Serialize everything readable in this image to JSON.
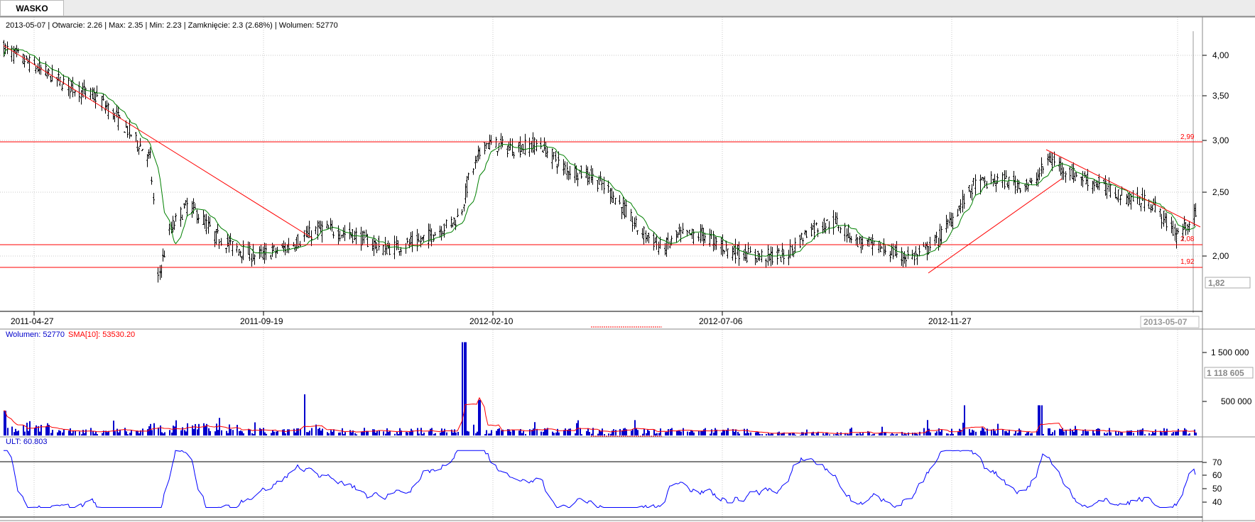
{
  "tab": {
    "label": "WASKO"
  },
  "info_line": "2013-05-07 | Otwarcie: 2.26 | Max: 2.35 | Min: 2.23 | Zamknięcie: 2.3 (2.68%)  | Wolumen: 52770",
  "price_axis_ticks": [
    "4,00",
    "3,50",
    "3,00",
    "2,50",
    "2,00"
  ],
  "date_ticks": [
    "2011-04-27",
    "2011-09-19",
    "2012-02-10",
    "2012-07-06",
    "2012-11-27"
  ],
  "current_date_label": "2013-05-07",
  "current_price_label": "1,82",
  "level_labels": [
    "2,99",
    "2,08",
    "1,92"
  ],
  "volume_legend": {
    "volume": "Wolumen: 52770",
    "sma": "SMA[10]: 53530.20"
  },
  "volume_axis_ticks": [
    "1 500 000",
    "1 118 605",
    "500 000"
  ],
  "ult_legend": "ULT: 60.803",
  "ult_axis_ticks": [
    "70",
    "60",
    "50",
    "40"
  ],
  "colors": {
    "candles": "#000000",
    "ma_line": "#008000",
    "trendlines": "#ff0000",
    "volume_bars": "#0000cc",
    "volume_sma": "#ff0000",
    "ult_line": "#0000ff",
    "grid": "#c8c8c8"
  },
  "chart_data": [
    {
      "type": "line",
      "title": "WASKO",
      "x_range": [
        "2011-04-27",
        "2013-05-07"
      ],
      "y_range": [
        1.7,
        4.25
      ],
      "price_path_keypoints": {
        "x": [
          "2011-04-27",
          "2011-05-16",
          "2011-06-06",
          "2011-06-25",
          "2011-07-15",
          "2011-07-27",
          "2011-08-01",
          "2011-08-09",
          "2011-08-20",
          "2011-09-05",
          "2011-09-19",
          "2011-10-01",
          "2011-10-18",
          "2011-11-10",
          "2011-12-01",
          "2011-12-20",
          "2012-01-10",
          "2012-01-25",
          "2012-02-05",
          "2012-02-10",
          "2012-02-20",
          "2012-03-10",
          "2012-03-25",
          "2012-04-10",
          "2012-04-25",
          "2012-05-08",
          "2012-05-25",
          "2012-06-10",
          "2012-06-20",
          "2012-07-06",
          "2012-07-20",
          "2012-08-05",
          "2012-08-25",
          "2012-09-10",
          "2012-09-25",
          "2012-10-10",
          "2012-10-25",
          "2012-11-05",
          "2012-11-15",
          "2012-11-27",
          "2012-12-10",
          "2012-12-20",
          "2013-01-05",
          "2013-01-25",
          "2013-02-05",
          "2013-02-20",
          "2013-03-10",
          "2013-03-25",
          "2013-04-10",
          "2013-04-25",
          "2013-05-07"
        ],
        "close": [
          4.1,
          3.85,
          3.6,
          3.45,
          3.05,
          2.8,
          1.85,
          2.2,
          2.4,
          2.15,
          2.05,
          2.0,
          2.05,
          2.2,
          2.15,
          2.05,
          2.1,
          2.2,
          2.3,
          2.6,
          2.95,
          2.9,
          2.95,
          2.7,
          2.65,
          2.5,
          2.2,
          2.05,
          2.15,
          2.15,
          2.05,
          2.0,
          2.0,
          2.2,
          2.25,
          2.1,
          2.05,
          2.0,
          2.0,
          2.1,
          2.35,
          2.55,
          2.6,
          2.55,
          2.8,
          2.65,
          2.55,
          2.45,
          2.4,
          2.15,
          2.3
        ]
      }
    },
    {
      "type": "bar",
      "title": "Wolumen",
      "x_range": [
        "2011-04-27",
        "2013-05-07"
      ],
      "y_range": [
        0,
        1900000
      ],
      "last_volume": 52770,
      "sma_10": 53530.2,
      "notable_peaks": {
        "x": [
          "2011-04-27",
          "2011-10-30",
          "2012-02-07",
          "2012-02-17",
          "2012-12-15",
          "2013-01-30"
        ],
        "values": [
          450000,
          750000,
          1700000,
          650000,
          550000,
          550000
        ]
      }
    },
    {
      "type": "line",
      "title": "ULT",
      "x_range": [
        "2011-04-27",
        "2013-05-07"
      ],
      "y_range": [
        33,
        80
      ],
      "last_value": 60.803,
      "reference_levels": [
        30,
        70
      ]
    }
  ]
}
